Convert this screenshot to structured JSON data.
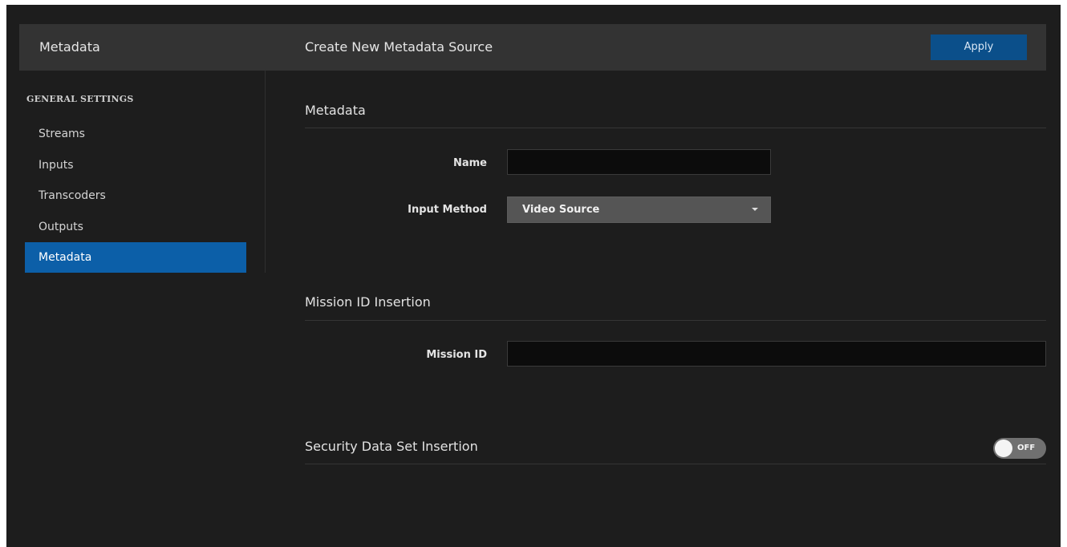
{
  "header": {
    "app_title": "Metadata",
    "page_title": "Create New Metadata Source",
    "apply_label": "Apply"
  },
  "sidebar": {
    "heading": "GENERAL SETTINGS",
    "items": [
      {
        "label": "Streams",
        "active": false
      },
      {
        "label": "Inputs",
        "active": false
      },
      {
        "label": "Transcoders",
        "active": false
      },
      {
        "label": "Outputs",
        "active": false
      },
      {
        "label": "Metadata",
        "active": true
      }
    ]
  },
  "sections": {
    "metadata": {
      "title": "Metadata",
      "name_label": "Name",
      "name_value": "",
      "input_method_label": "Input Method",
      "input_method_value": "Video Source"
    },
    "mission": {
      "title": "Mission ID Insertion",
      "mission_id_label": "Mission ID",
      "mission_id_value": ""
    },
    "security": {
      "title": "Security Data Set Insertion",
      "toggle_state": "OFF"
    }
  },
  "colors": {
    "accent": "#0c5fa8",
    "apply_button": "#0b4f8a",
    "background": "#1d1d1d",
    "topbar": "#333333"
  }
}
